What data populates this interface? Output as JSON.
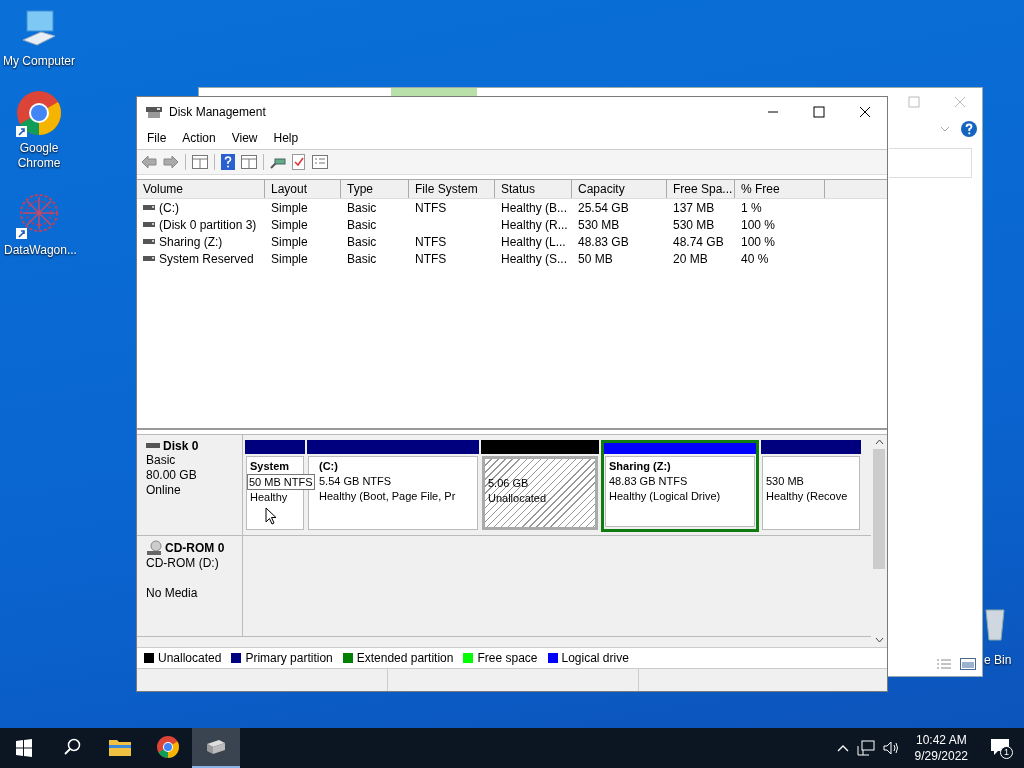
{
  "desktop_icons": [
    {
      "kind": "computer",
      "label": "My Computer"
    },
    {
      "kind": "chrome",
      "label": "Google Chrome"
    },
    {
      "kind": "datawagon",
      "label": "DataWagon..."
    }
  ],
  "recycle_label": "e Bin",
  "window": {
    "title": "Disk Management",
    "menu": [
      "File",
      "Action",
      "View",
      "Help"
    ]
  },
  "table": {
    "columns": [
      "Volume",
      "Layout",
      "Type",
      "File System",
      "Status",
      "Capacity",
      "Free Spa...",
      "% Free"
    ],
    "rows": [
      [
        "(C:)",
        "Simple",
        "Basic",
        "NTFS",
        "Healthy (B...",
        "25.54 GB",
        "137 MB",
        "1 %"
      ],
      [
        "(Disk 0 partition 3)",
        "Simple",
        "Basic",
        "",
        "Healthy (R...",
        "530 MB",
        "530 MB",
        "100 %"
      ],
      [
        "Sharing (Z:)",
        "Simple",
        "Basic",
        "NTFS",
        "Healthy (L...",
        "48.83 GB",
        "48.74 GB",
        "100 %"
      ],
      [
        "System Reserved",
        "Simple",
        "Basic",
        "NTFS",
        "Healthy (S...",
        "50 MB",
        "20 MB",
        "40 %"
      ]
    ]
  },
  "disks": [
    {
      "kind": "disk",
      "name": "Disk 0",
      "lines": [
        "Basic",
        "80.00 GB",
        "Online"
      ],
      "partitions": [
        {
          "kind": "primary",
          "name": "System",
          "size": "50 MB NTFS",
          "status": "Healthy",
          "selected": false,
          "hovered": true
        },
        {
          "kind": "primary",
          "name": "(C:)",
          "size": "5.54 GB NTFS",
          "status": "Healthy (Boot, Page File, Pr",
          "selected": false,
          "hovered": false
        },
        {
          "kind": "unallocated",
          "size": "5.06 GB",
          "status": "Unallocated",
          "selected": false,
          "hovered": false
        },
        {
          "kind": "logical",
          "name": "Sharing  (Z:)",
          "size": "48.83 GB NTFS",
          "status": "Healthy (Logical Drive)",
          "selected": true,
          "hovered": false
        },
        {
          "kind": "primary",
          "size": "530 MB",
          "status": "Healthy (Recove",
          "selected": false,
          "hovered": false
        }
      ]
    },
    {
      "kind": "cdrom",
      "name": "CD-ROM 0",
      "lines": [
        "CD-ROM (D:)",
        "No Media"
      ]
    }
  ],
  "legend": [
    {
      "label": "Unallocated",
      "color": "#000000"
    },
    {
      "label": "Primary partition",
      "color": "#000080"
    },
    {
      "label": "Extended partition",
      "color": "#007f00"
    },
    {
      "label": "Free space",
      "color": "#00ff00"
    },
    {
      "label": "Logical drive",
      "color": "#0000ff"
    }
  ],
  "taskbar": {
    "apps": [
      {
        "kind": "explorer",
        "active": false
      },
      {
        "kind": "chrome",
        "active": false
      },
      {
        "kind": "diskmgmt",
        "active": true
      }
    ],
    "time": "10:42 AM",
    "date": "9/29/2022",
    "notifications": "1"
  }
}
